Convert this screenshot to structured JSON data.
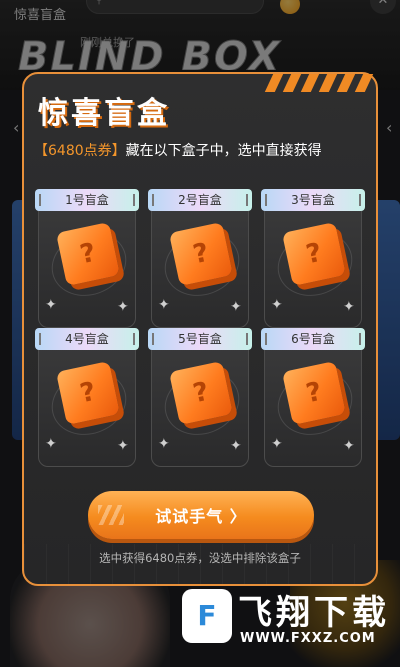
{
  "background": {
    "page_title": "惊喜盲盒",
    "banner_text": "BLIND BOX",
    "notice_text": "刚刚兑换了"
  },
  "modal": {
    "title": "惊喜盲盒",
    "price_tag": "【6480点券】",
    "description": "藏在以下盒子中，选中直接获得",
    "boxes": [
      {
        "label": "1号盲盒",
        "symbol": "?"
      },
      {
        "label": "2号盲盒",
        "symbol": "?"
      },
      {
        "label": "3号盲盒",
        "symbol": "?"
      },
      {
        "label": "4号盲盒",
        "symbol": "?"
      },
      {
        "label": "5号盲盒",
        "symbol": "?"
      },
      {
        "label": "6号盲盒",
        "symbol": "?"
      }
    ],
    "cta_label": "试试手气 〉",
    "footnote": "选中获得6480点券，没选中排除该盒子"
  },
  "watermark": {
    "logo_glyph": "F",
    "text": "飞翔下载",
    "url": "WWW.FXXZ.COM"
  },
  "colors": {
    "accent": "#f58b1e",
    "modal_bg": "#2a2a2b",
    "border": "#e8903a"
  },
  "icons": [
    "search-icon",
    "coin-icon",
    "close-icon",
    "sparkle-icon",
    "question-cube-icon",
    "arrow-left-icon",
    "arrow-right-icon"
  ]
}
